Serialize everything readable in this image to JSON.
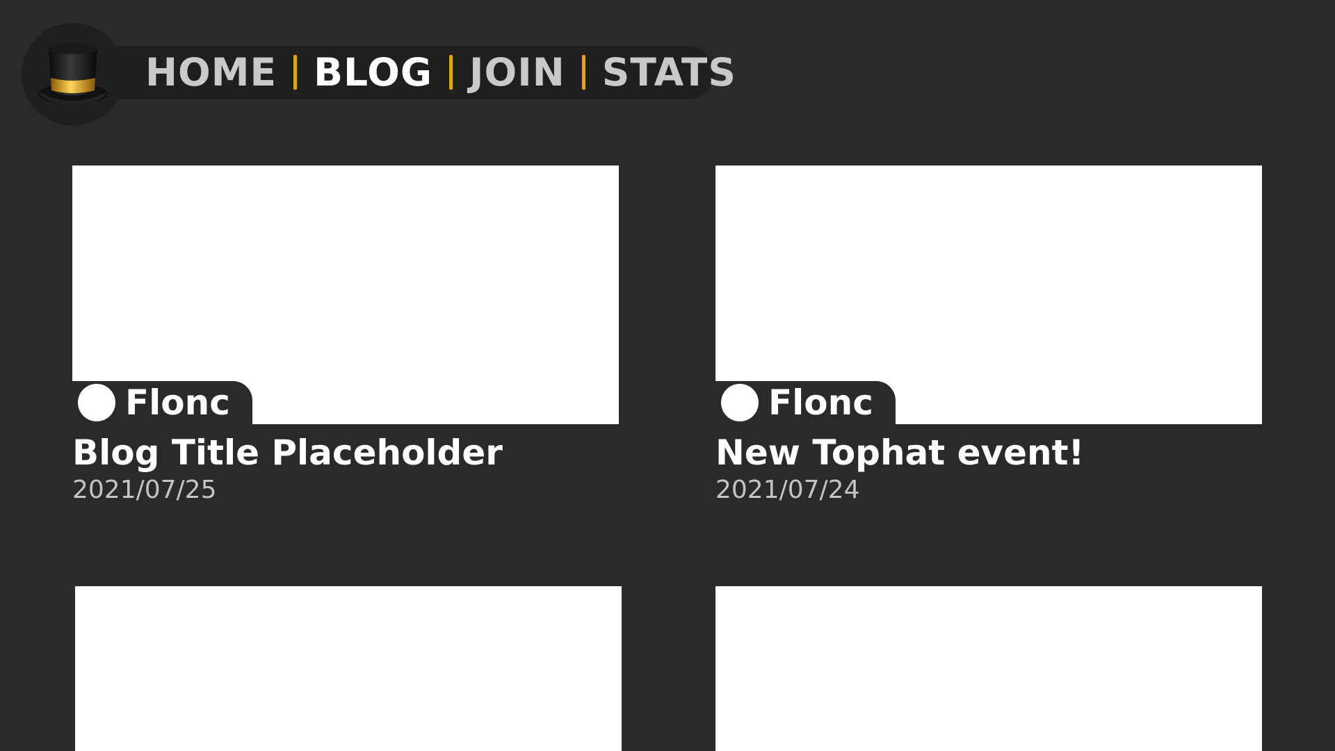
{
  "nav": {
    "logo_icon": "top-hat-icon",
    "links": [
      "HOME",
      "BLOG",
      "JOIN",
      "STATS"
    ],
    "active": "BLOG",
    "separator_color": "#e8a800"
  },
  "posts": [
    {
      "author": "Flonc",
      "title": "Blog Title Placeholder",
      "date": "2021/07/25"
    },
    {
      "author": "Flonc",
      "title": "New Tophat event!",
      "date": "2021/07/24"
    },
    {
      "author": "",
      "title": "",
      "date": ""
    },
    {
      "author": "",
      "title": "",
      "date": ""
    }
  ],
  "colors": {
    "background": "#2a2a2a",
    "nav_pill": "#1f1f1f",
    "accent": "#e8a800"
  }
}
